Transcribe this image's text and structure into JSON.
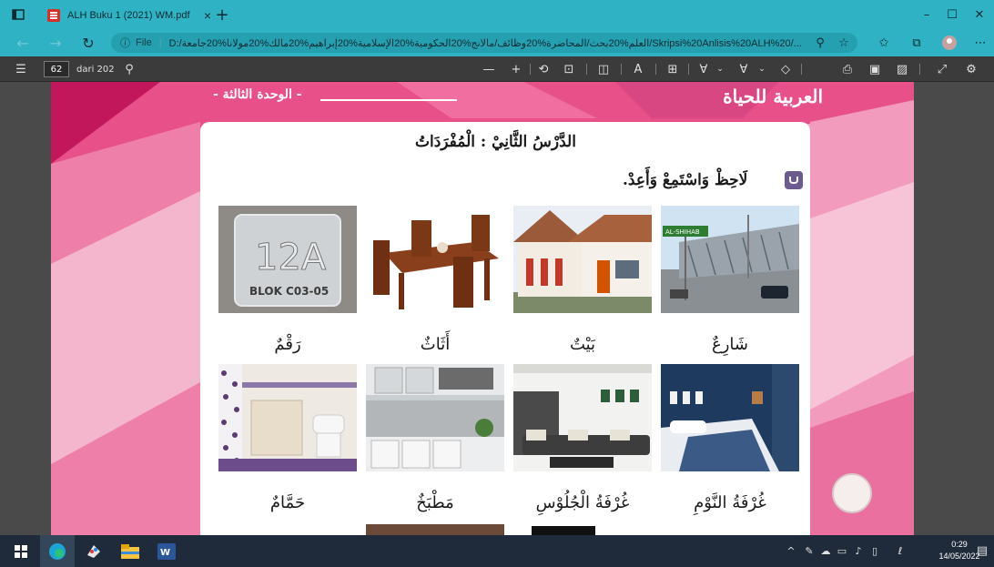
{
  "browser": {
    "tab_title": "ALH Buku 1 (2021) WM.pdf",
    "tab_close": "×",
    "new_tab": "+",
    "address_info": "ⓘ",
    "address_scheme": "File",
    "address_url": "D:/العلم%20بحث/المحاضرة%20وظائف/مالانج%20الحكومية%20الإسلامية%20إبراهيم%20مالك%20مولانا%20جامعة/Skripsi%20Anlisis%20ALH%20/...",
    "minimize": "–",
    "maximize": "☐",
    "close": "✕"
  },
  "pdf_toolbar": {
    "page_number": "62",
    "page_total": "dari 202"
  },
  "document": {
    "header_title": "العربية للحياة",
    "header_unit": "- الوحدة الثالثة -",
    "lesson_title": "الدَّرْسُ الثَّانِيْ : الْمُفْرَدَاتُ",
    "instruction": "لَاحِظْ وَاسْتَمِعْ وَأَعِدْ.",
    "vocab": [
      {
        "word": "شَارِعٌ",
        "image": "street-bridge-image"
      },
      {
        "word": "بَيْتٌ",
        "image": "house-image"
      },
      {
        "word": "أَثَاثٌ",
        "image": "dining-furniture-image"
      },
      {
        "word": "رَقْمٌ",
        "image": "number-plate-image"
      },
      {
        "word": "غُرْفَةُ النَّوْمِ",
        "image": "bedroom-image"
      },
      {
        "word": "غُرْفَةُ الْجُلُوْسِ",
        "image": "living-room-image"
      },
      {
        "word": "مَطْبَخٌ",
        "image": "kitchen-image"
      },
      {
        "word": "حَمَّامٌ",
        "image": "bathroom-image"
      }
    ],
    "sign_text": "AL-SHIHAB",
    "plate_number": "12A",
    "plate_block": "BLOK C03-05"
  },
  "taskbar": {
    "time": "0:29",
    "date": "14/05/2022"
  },
  "colors": {
    "chrome": "#2fb3c4",
    "pdf_toolbar": "#3b3b3b",
    "page_pink": "#e8508a",
    "taskbar": "#1f2b3a"
  }
}
